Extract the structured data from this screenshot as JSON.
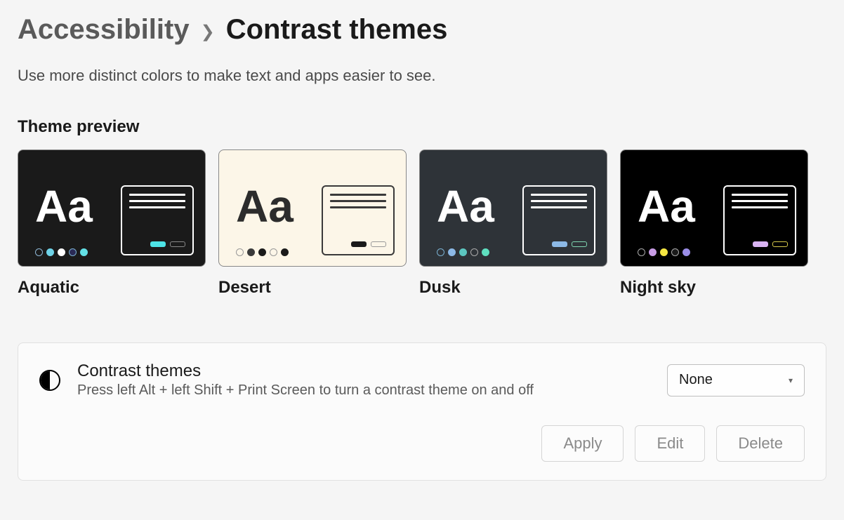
{
  "breadcrumb": {
    "parent": "Accessibility",
    "current": "Contrast themes"
  },
  "subtitle": "Use more distinct colors to make text and apps easier to see.",
  "section_label": "Theme preview",
  "themes": [
    {
      "name": "Aquatic",
      "bg": "#1a1a1a",
      "aa_color": "#ffffff",
      "swatches": [
        {
          "fill": "transparent",
          "border": "#8fb8d6"
        },
        {
          "fill": "#6fd3e8",
          "border": "#6fd3e8"
        },
        {
          "fill": "#ffffff",
          "border": "#ffffff"
        },
        {
          "fill": "#2a2a55",
          "border": "#7ab0d0"
        },
        {
          "fill": "#63e0e6",
          "border": "#63e0e6"
        }
      ],
      "window_border": "#ffffff",
      "line_color": "#ffffff",
      "btn1": {
        "fill": "#4de3e6"
      },
      "btn2": {
        "outline": "#888"
      }
    },
    {
      "name": "Desert",
      "bg": "#fcf6e8",
      "aa_color": "#2c2c2c",
      "swatches": [
        {
          "fill": "transparent",
          "border": "#999"
        },
        {
          "fill": "#3a3a3a",
          "border": "#3a3a3a"
        },
        {
          "fill": "#1a1a1a",
          "border": "#1a1a1a"
        },
        {
          "fill": "transparent",
          "border": "#999"
        },
        {
          "fill": "#1a1a1a",
          "border": "#1a1a1a"
        }
      ],
      "window_border": "#3a3a3a",
      "line_color": "#3a3a3a",
      "btn1": {
        "fill": "#1a1a1a"
      },
      "btn2": {
        "outline": "#999"
      }
    },
    {
      "name": "Dusk",
      "bg": "#2e3338",
      "aa_color": "#ffffff",
      "swatches": [
        {
          "fill": "transparent",
          "border": "#7ab0d0"
        },
        {
          "fill": "#8cb9e6",
          "border": "#8cb9e6"
        },
        {
          "fill": "#5cc6c0",
          "border": "#5cc6c0"
        },
        {
          "fill": "transparent",
          "border": "#aaa"
        },
        {
          "fill": "#5fe0c0",
          "border": "#5fe0c0"
        }
      ],
      "window_border": "#ffffff",
      "line_color": "#ffffff",
      "btn1": {
        "fill": "#8cb9e6"
      },
      "btn2": {
        "outline": "#7fd6b0"
      }
    },
    {
      "name": "Night sky",
      "bg": "#000000",
      "aa_color": "#ffffff",
      "swatches": [
        {
          "fill": "transparent",
          "border": "#aaa"
        },
        {
          "fill": "#c99de6",
          "border": "#c99de6"
        },
        {
          "fill": "#f5e642",
          "border": "#f5e642"
        },
        {
          "fill": "#1a1a1a",
          "border": "#aaa"
        },
        {
          "fill": "#9a8de6",
          "border": "#9a8de6"
        }
      ],
      "window_border": "#ffffff",
      "line_color": "#ffffff",
      "btn1": {
        "fill": "#d9b3f2"
      },
      "btn2": {
        "outline": "#d6c94a"
      }
    }
  ],
  "settings": {
    "title": "Contrast themes",
    "description": "Press left Alt + left Shift + Print Screen to turn a contrast theme on and off",
    "dropdown_value": "None",
    "buttons": {
      "apply": "Apply",
      "edit": "Edit",
      "delete": "Delete"
    }
  }
}
